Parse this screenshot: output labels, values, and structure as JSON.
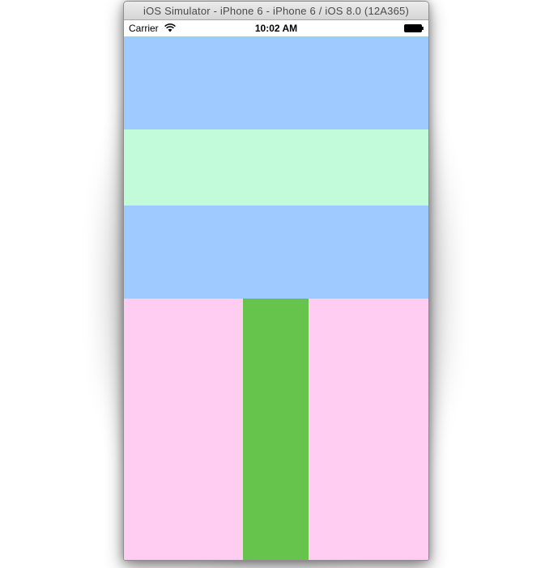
{
  "window": {
    "title": "iOS Simulator - iPhone 6 - iPhone 6 / iOS 8.0 (12A365)"
  },
  "status_bar": {
    "carrier": "Carrier",
    "time": "10:02 AM",
    "wifi_icon": "wifi-icon",
    "battery_icon": "battery-icon"
  },
  "colors": {
    "light_blue": "#9fcaff",
    "light_mint": "#c2fbd9",
    "light_pink": "#fecdf1",
    "green": "#66c44c"
  }
}
